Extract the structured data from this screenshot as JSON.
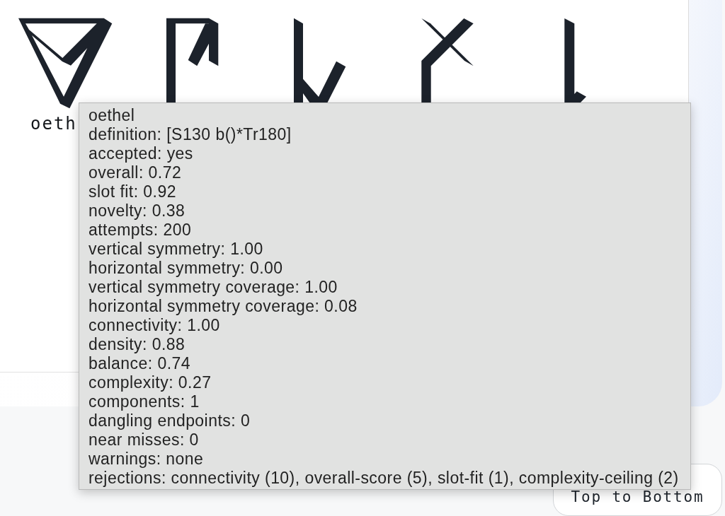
{
  "glyphs": [
    {
      "kind": "triangle",
      "label": "oeth"
    },
    {
      "kind": "flag"
    },
    {
      "kind": "hook"
    },
    {
      "kind": "cross"
    },
    {
      "kind": "stem"
    }
  ],
  "tooltip": {
    "title": "oethel",
    "lines": [
      "definition: [S130 b()*Tr180]",
      "accepted: yes",
      "overall: 0.72",
      "slot fit: 0.92",
      "novelty: 0.38",
      "attempts: 200",
      "vertical symmetry: 1.00",
      "horizontal symmetry: 0.00",
      "vertical symmetry coverage: 1.00",
      "horizontal symmetry coverage: 0.08",
      "connectivity: 1.00",
      "density: 0.88",
      "balance: 0.74",
      "complexity: 0.27",
      "components: 1",
      "dangling endpoints: 0",
      "near misses: 0",
      "warnings: none",
      "rejections: connectivity (10), overall-score (5), slot-fit (1), complexity-ceiling (2)"
    ]
  },
  "button": {
    "label": "Top to Bottom"
  }
}
